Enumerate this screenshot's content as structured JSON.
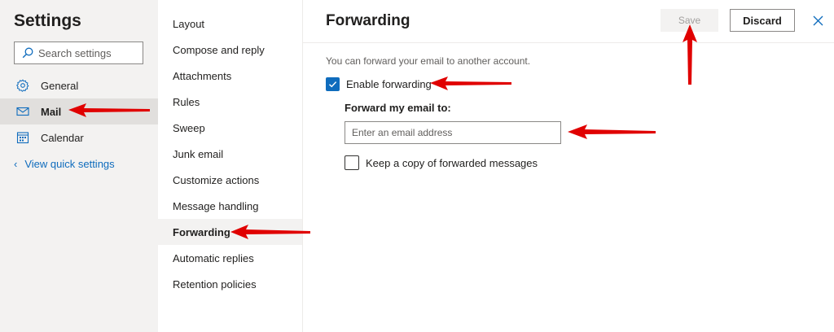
{
  "left_pane": {
    "title": "Settings",
    "search_placeholder": "Search settings",
    "nav": [
      {
        "label": "General",
        "icon": "gear-icon"
      },
      {
        "label": "Mail",
        "icon": "mail-icon",
        "selected": true
      },
      {
        "label": "Calendar",
        "icon": "calendar-icon"
      }
    ],
    "view_quick_settings": "View quick settings"
  },
  "categories": [
    {
      "label": "Layout"
    },
    {
      "label": "Compose and reply"
    },
    {
      "label": "Attachments"
    },
    {
      "label": "Rules"
    },
    {
      "label": "Sweep"
    },
    {
      "label": "Junk email"
    },
    {
      "label": "Customize actions"
    },
    {
      "label": "Message handling"
    },
    {
      "label": "Forwarding",
      "selected": true
    },
    {
      "label": "Automatic replies"
    },
    {
      "label": "Retention policies"
    }
  ],
  "forwarding": {
    "title": "Forwarding",
    "save_label": "Save",
    "discard_label": "Discard",
    "description": "You can forward your email to another account.",
    "enable_label": "Enable forwarding",
    "enable_checked": true,
    "forward_to_label": "Forward my email to:",
    "email_placeholder": "Enter an email address",
    "email_value": "",
    "keep_copy_label": "Keep a copy of forwarded messages",
    "keep_copy_checked": false
  },
  "colors": {
    "accent": "#0f6cbd",
    "annotation_arrow": "#e00000"
  }
}
